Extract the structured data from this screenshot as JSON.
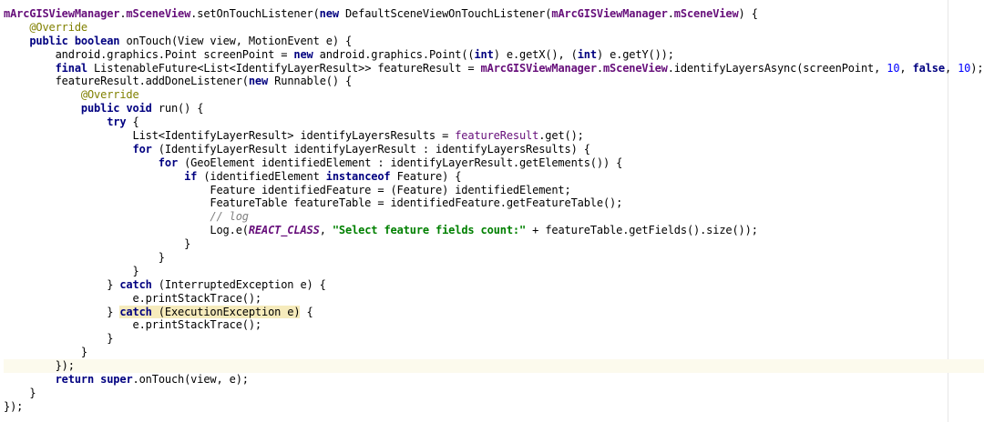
{
  "colors": {
    "keyword": "#000080",
    "field": "#660e7a",
    "annotation": "#808000",
    "number": "#0000ff",
    "string": "#008000",
    "comment": "#808080",
    "current_line": "#fcfaed",
    "match_highlight": "#f6ebbc"
  },
  "lines": [
    {
      "indent": 0,
      "tokens": [
        {
          "t": "mArcGISViewManager",
          "c": "fld"
        },
        {
          "t": ".",
          "c": "pl"
        },
        {
          "t": "mSceneView",
          "c": "fld"
        },
        {
          "t": ".setOnTouchListener(",
          "c": "pl"
        },
        {
          "t": "new",
          "c": "kw"
        },
        {
          "t": " DefaultSceneViewOnTouchListener(",
          "c": "pl"
        },
        {
          "t": "mArcGISViewManager",
          "c": "fld"
        },
        {
          "t": ".",
          "c": "pl"
        },
        {
          "t": "mSceneView",
          "c": "fld"
        },
        {
          "t": ") {",
          "c": "pl"
        }
      ]
    },
    {
      "indent": 4,
      "tokens": [
        {
          "t": "@Override",
          "c": "ann"
        }
      ]
    },
    {
      "indent": 4,
      "tokens": [
        {
          "t": "public",
          "c": "kw"
        },
        {
          "t": " ",
          "c": "pl"
        },
        {
          "t": "boolean",
          "c": "kw"
        },
        {
          "t": " onTouch(View view, MotionEvent e) {",
          "c": "pl"
        }
      ]
    },
    {
      "indent": 8,
      "tokens": [
        {
          "t": "android.graphics.Point screenPoint = ",
          "c": "pl"
        },
        {
          "t": "new",
          "c": "kw"
        },
        {
          "t": " android.graphics.Point((",
          "c": "pl"
        },
        {
          "t": "int",
          "c": "kw"
        },
        {
          "t": ") e.getX(), (",
          "c": "pl"
        },
        {
          "t": "int",
          "c": "kw"
        },
        {
          "t": ") e.getY());",
          "c": "pl"
        }
      ]
    },
    {
      "indent": 8,
      "tokens": [
        {
          "t": "final",
          "c": "kw"
        },
        {
          "t": " ListenableFuture<List<IdentifyLayerResult>> featureResult = ",
          "c": "pl"
        },
        {
          "t": "mArcGISViewManager",
          "c": "fld"
        },
        {
          "t": ".",
          "c": "pl"
        },
        {
          "t": "mSceneView",
          "c": "fld"
        },
        {
          "t": ".identifyLayersAsync(screenPoint, ",
          "c": "pl"
        },
        {
          "t": "10",
          "c": "num"
        },
        {
          "t": ", ",
          "c": "pl"
        },
        {
          "t": "false",
          "c": "kw"
        },
        {
          "t": ", ",
          "c": "pl"
        },
        {
          "t": "10",
          "c": "num"
        },
        {
          "t": ");",
          "c": "pl"
        }
      ]
    },
    {
      "indent": 8,
      "tokens": [
        {
          "t": "featureResult.addDoneListener(",
          "c": "pl"
        },
        {
          "t": "new",
          "c": "kw"
        },
        {
          "t": " Runnable() {",
          "c": "pl"
        }
      ]
    },
    {
      "indent": 12,
      "tokens": [
        {
          "t": "@Override",
          "c": "ann"
        }
      ]
    },
    {
      "indent": 12,
      "tokens": [
        {
          "t": "public",
          "c": "kw"
        },
        {
          "t": " ",
          "c": "pl"
        },
        {
          "t": "void",
          "c": "kw"
        },
        {
          "t": " run() {",
          "c": "pl"
        }
      ]
    },
    {
      "indent": 16,
      "tokens": [
        {
          "t": "try",
          "c": "kw"
        },
        {
          "t": " {",
          "c": "pl"
        }
      ]
    },
    {
      "indent": 20,
      "tokens": [
        {
          "t": "List<IdentifyLayerResult> identifyLayersResults = ",
          "c": "pl"
        },
        {
          "t": "featureResult",
          "c": "fld2"
        },
        {
          "t": ".get();",
          "c": "pl"
        }
      ]
    },
    {
      "indent": 20,
      "tokens": [
        {
          "t": "for",
          "c": "kw"
        },
        {
          "t": " (IdentifyLayerResult identifyLayerResult : identifyLayersResults) {",
          "c": "pl"
        }
      ]
    },
    {
      "indent": 24,
      "tokens": [
        {
          "t": "for",
          "c": "kw"
        },
        {
          "t": " (GeoElement identifiedElement : identifyLayerResult.getElements()) {",
          "c": "pl"
        }
      ]
    },
    {
      "indent": 28,
      "tokens": [
        {
          "t": "if",
          "c": "kw"
        },
        {
          "t": " (identifiedElement ",
          "c": "pl"
        },
        {
          "t": "instanceof",
          "c": "kw"
        },
        {
          "t": " Feature) {",
          "c": "pl"
        }
      ]
    },
    {
      "indent": 32,
      "tokens": [
        {
          "t": "Feature identifiedFeature = (Feature) identifiedElement;",
          "c": "pl"
        }
      ]
    },
    {
      "indent": 32,
      "tokens": [
        {
          "t": "FeatureTable featureTable = identifiedFeature.getFeatureTable();",
          "c": "pl"
        }
      ]
    },
    {
      "indent": 32,
      "tokens": [
        {
          "t": "// log",
          "c": "cmt"
        }
      ]
    },
    {
      "indent": 32,
      "tokens": [
        {
          "t": "Log.",
          "c": "pl"
        },
        {
          "t": "e",
          "c": "pl"
        },
        {
          "t": "(",
          "c": "pl"
        },
        {
          "t": "REACT_CLASS",
          "c": "const"
        },
        {
          "t": ", ",
          "c": "pl"
        },
        {
          "t": "\"Select feature fields count:\"",
          "c": "str"
        },
        {
          "t": " + featureTable.getFields().size());",
          "c": "pl"
        }
      ]
    },
    {
      "indent": 28,
      "tokens": [
        {
          "t": "}",
          "c": "pl"
        }
      ]
    },
    {
      "indent": 24,
      "tokens": [
        {
          "t": "}",
          "c": "pl"
        }
      ]
    },
    {
      "indent": 20,
      "tokens": [
        {
          "t": "}",
          "c": "pl"
        }
      ]
    },
    {
      "indent": 16,
      "tokens": [
        {
          "t": "} ",
          "c": "pl"
        },
        {
          "t": "catch",
          "c": "kw"
        },
        {
          "t": " (InterruptedException e) {",
          "c": "pl"
        }
      ]
    },
    {
      "indent": 20,
      "tokens": [
        {
          "t": "e.printStackTrace();",
          "c": "pl"
        }
      ]
    },
    {
      "indent": 16,
      "tokens": [
        {
          "t": "} ",
          "c": "pl"
        },
        {
          "t": "catch",
          "c": "kw hl"
        },
        {
          "t": " (ExecutionException e)",
          "c": "pl hl"
        },
        {
          "t": " {",
          "c": "pl"
        }
      ]
    },
    {
      "indent": 20,
      "tokens": [
        {
          "t": "e.printStackTrace();",
          "c": "pl"
        }
      ]
    },
    {
      "indent": 16,
      "tokens": [
        {
          "t": "}",
          "c": "pl"
        }
      ]
    },
    {
      "indent": 12,
      "tokens": [
        {
          "t": "}",
          "c": "pl"
        }
      ]
    },
    {
      "indent": 8,
      "current": true,
      "tokens": [
        {
          "t": "});",
          "c": "pl"
        }
      ]
    },
    {
      "indent": 8,
      "tokens": [
        {
          "t": "return",
          "c": "kw"
        },
        {
          "t": " ",
          "c": "pl"
        },
        {
          "t": "super",
          "c": "kw"
        },
        {
          "t": ".onTouch(view, e);",
          "c": "pl"
        }
      ]
    },
    {
      "indent": 4,
      "tokens": [
        {
          "t": "}",
          "c": "pl"
        }
      ]
    },
    {
      "indent": 0,
      "tokens": [
        {
          "t": "});",
          "c": "pl"
        }
      ]
    }
  ]
}
